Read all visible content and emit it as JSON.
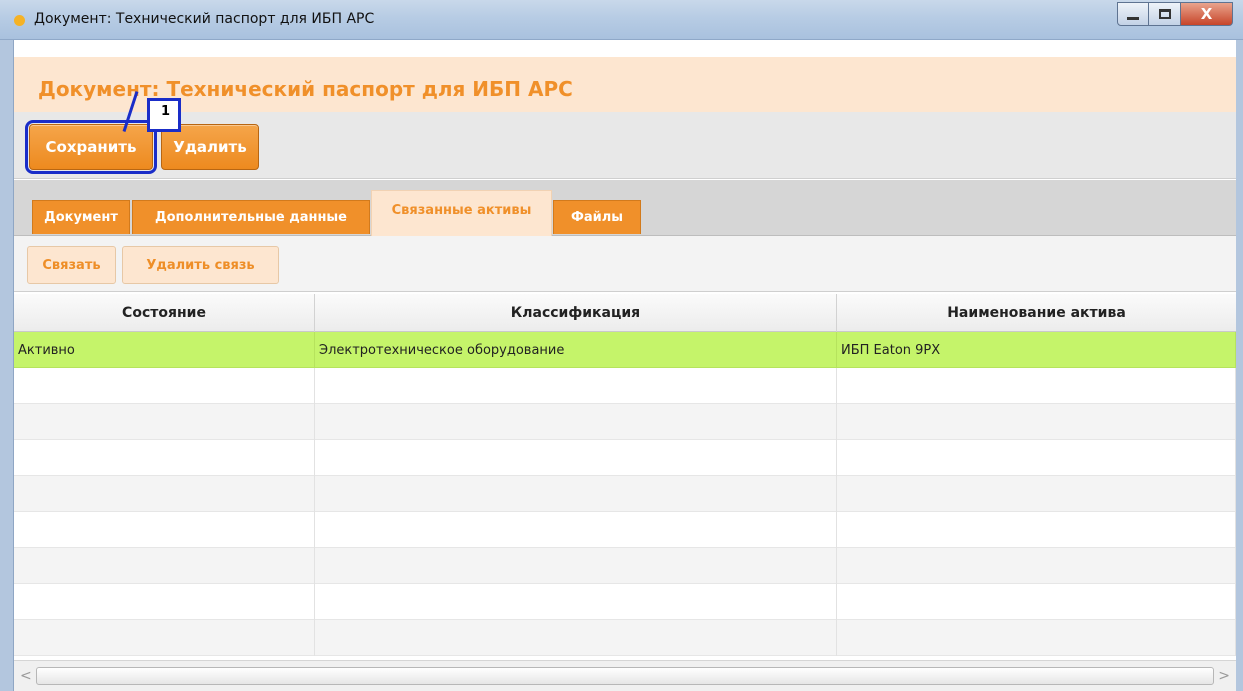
{
  "window": {
    "title": "Документ: Технический паспорт для ИБП APC",
    "minimize_icon": "minimize-icon",
    "maximize_icon": "maximize-icon",
    "close_label": "X"
  },
  "header": {
    "title": "Документ: Технический паспорт для ИБП APC"
  },
  "toolbar": {
    "save_label": "Сохранить",
    "delete_label": "Удалить"
  },
  "annotation": {
    "marker_number": "1"
  },
  "tabs": [
    {
      "label": "Документ",
      "active": false
    },
    {
      "label": "Дополнительные данные",
      "active": false
    },
    {
      "label": "Связанные активы",
      "active": true
    },
    {
      "label": "Файлы",
      "active": false
    }
  ],
  "subtoolbar": {
    "link_label": "Связать",
    "unlink_label": "Удалить связь"
  },
  "table": {
    "columns": [
      "Состояние",
      "Классификация",
      "Наименование актива"
    ],
    "rows": [
      [
        "Активно",
        "Электротехническое оборудование",
        "ИБП Eaton 9PX"
      ]
    ],
    "selected_row": 0,
    "selected_color": "#c5f46a"
  },
  "scrollbar": {
    "left_arrow": "<",
    "right_arrow": ">"
  },
  "colors": {
    "accent": "#f0902a",
    "header_bg": "#fde6d0",
    "marker": "#1a2dc8"
  }
}
